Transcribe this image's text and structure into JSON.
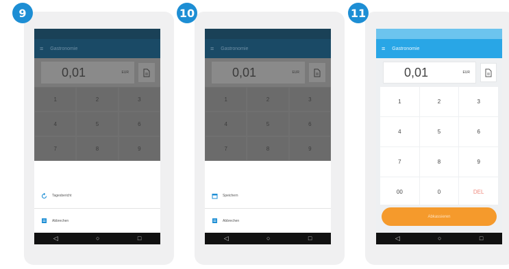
{
  "steps": [
    "9",
    "10",
    "11"
  ],
  "app": {
    "title": "Gastronomie",
    "amount": "0,01",
    "currency": "EUR"
  },
  "keypad": [
    "1",
    "2",
    "3",
    "4",
    "5",
    "6",
    "7",
    "8",
    "9",
    "00",
    "0",
    "DEL"
  ],
  "sheet_step9": [
    "Tagesbericht",
    "Abbrechen"
  ],
  "sheet_step10": [
    "Speichern",
    "Abbrechen"
  ],
  "pay_label": "Abkassieren",
  "nav": {
    "back": "◁",
    "home": "○",
    "recents": "□"
  },
  "colors": {
    "badge": "#1d8ed4",
    "accent": "#29a6e6",
    "pay": "#f59a2c",
    "delete": "#f08a7e"
  }
}
